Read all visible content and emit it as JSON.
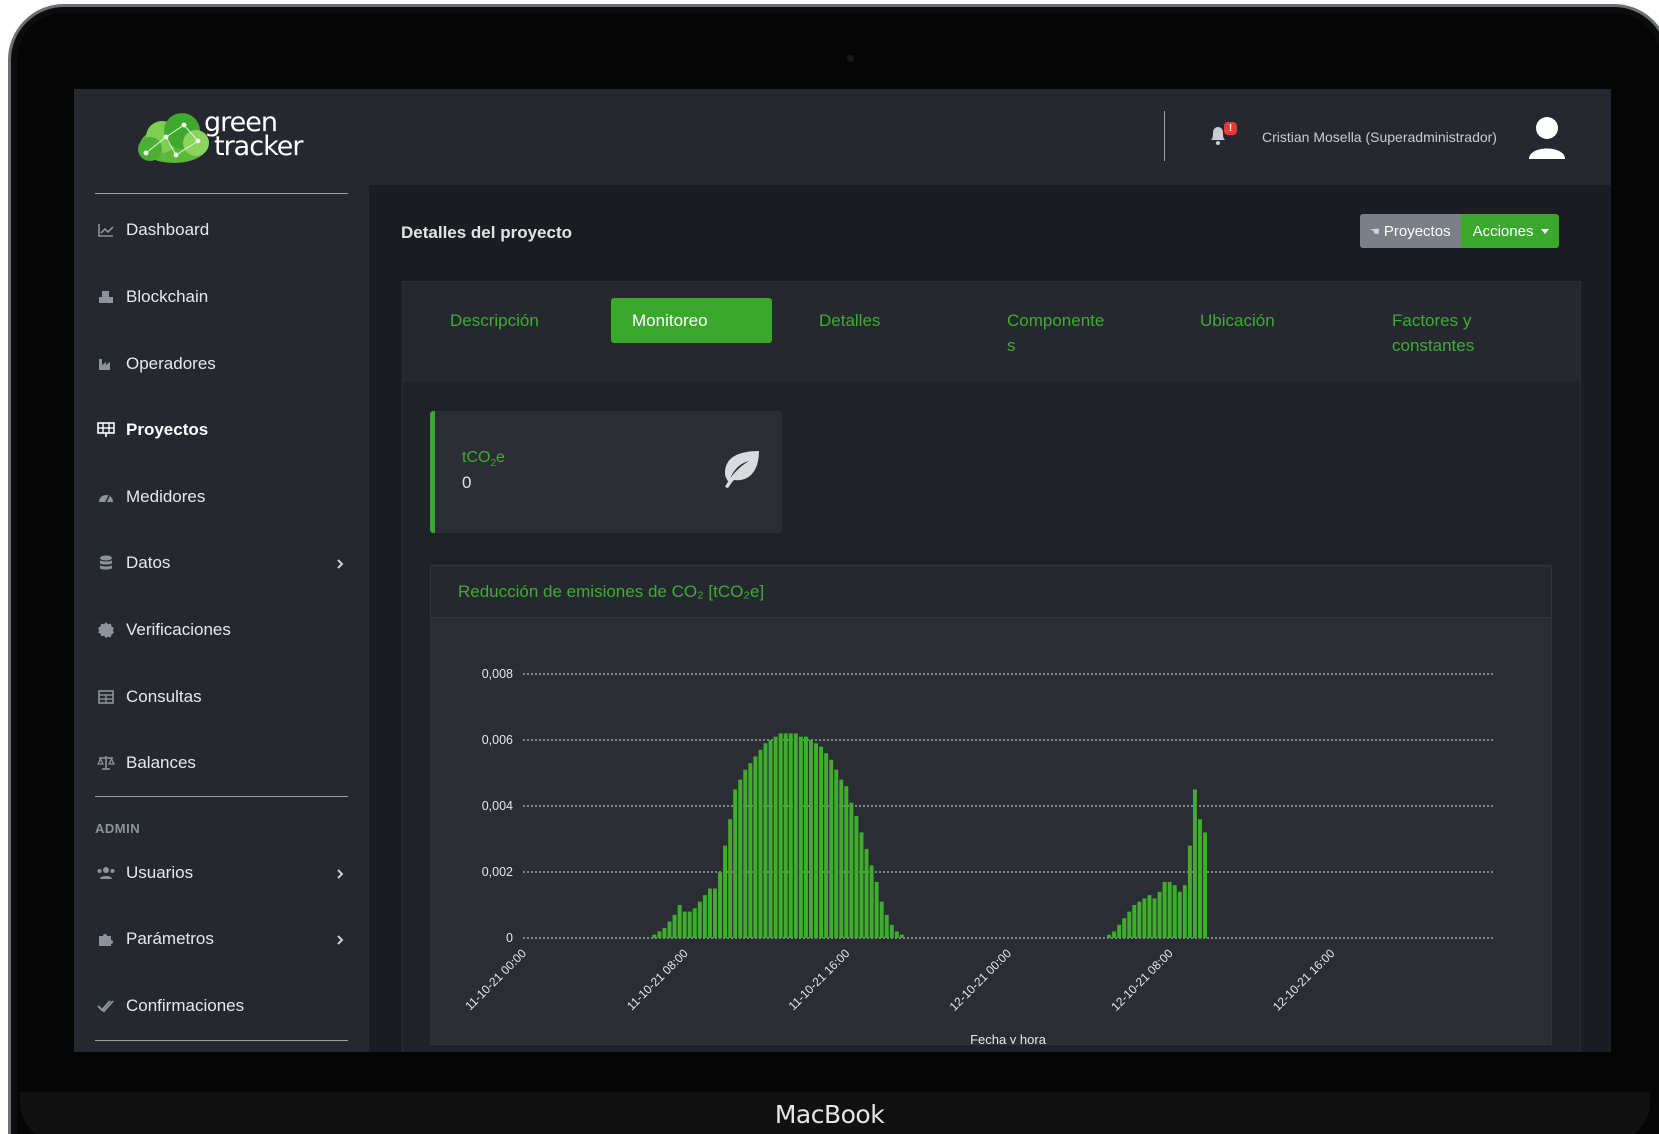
{
  "device_label": "MacBook",
  "brand": {
    "line1": "green",
    "line2": "tracker"
  },
  "sidebar": {
    "items": [
      {
        "label": "Dashboard",
        "icon": "chart-line-icon"
      },
      {
        "label": "Blockchain",
        "icon": "cubes-icon"
      },
      {
        "label": "Operadores",
        "icon": "industry-icon"
      },
      {
        "label": "Proyectos",
        "icon": "solar-panel-icon",
        "active": true
      },
      {
        "label": "Medidores",
        "icon": "gauge-icon"
      },
      {
        "label": "Datos",
        "icon": "database-icon",
        "has_submenu": true
      },
      {
        "label": "Verificaciones",
        "icon": "certificate-icon"
      },
      {
        "label": "Consultas",
        "icon": "table-icon"
      },
      {
        "label": "Balances",
        "icon": "scale-icon"
      }
    ],
    "admin_label": "ADMIN",
    "admin_items": [
      {
        "label": "Usuarios",
        "icon": "users-icon",
        "has_submenu": true
      },
      {
        "label": "Parámetros",
        "icon": "puzzle-icon",
        "has_submenu": true
      },
      {
        "label": "Confirmaciones",
        "icon": "check-double-icon"
      }
    ]
  },
  "topbar": {
    "notification_badge": "!",
    "user_name": "Cristian Mosella (Superadministrador)"
  },
  "page": {
    "title": "Detalles del proyecto",
    "buttons": {
      "projects": "Proyectos",
      "actions": "Acciones"
    }
  },
  "tabs": [
    {
      "label": "Descripción"
    },
    {
      "label": "Monitoreo",
      "active": true
    },
    {
      "label": "Detalles"
    },
    {
      "label": "Componente\ns"
    },
    {
      "label": "Ubicación"
    },
    {
      "label": "Factores y\nconstantes"
    }
  ],
  "stat": {
    "label_prefix": "tCO",
    "label_sub": "2",
    "label_suffix": "e",
    "value": "0"
  },
  "chart_title": "Reducción de emisiones de CO₂ [tCO₂e]",
  "colors": {
    "accent": "#3aa82d",
    "bar": "#3fae2c",
    "background": "#1b1d22",
    "panel": "#25282e"
  },
  "chart_data": {
    "type": "bar",
    "xlabel": "Fecha y hora",
    "ylabel": "",
    "ylim": [
      0,
      0.008
    ],
    "yticks": [
      "0",
      "0,002",
      "0,004",
      "0,006",
      "0,008"
    ],
    "xticks": [
      "11-10-21 00:00",
      "11-10-21 08:00",
      "11-10-21 16:00",
      "12-10-21 00:00",
      "12-10-21 08:00",
      "12-10-21 16:00"
    ],
    "x_start": "11-10-21 00:00",
    "x_end": "13-10-21 00:00",
    "interval_minutes": 15,
    "series": [
      {
        "segments": [
          {
            "start": "11-10-21 06:30",
            "values": [
              0.0001,
              0.0002,
              0.0003,
              0.0005,
              0.0007,
              0.001,
              0.0008,
              0.0008,
              0.0009,
              0.0011,
              0.0013,
              0.0015,
              0.0015,
              0.002,
              0.0028,
              0.0036,
              0.0045,
              0.0048,
              0.0051,
              0.0053,
              0.0055,
              0.0057,
              0.0059,
              0.006,
              0.0061,
              0.0062,
              0.0062,
              0.0062,
              0.0062,
              0.0061,
              0.0061,
              0.006,
              0.0059,
              0.0058,
              0.0056,
              0.0054,
              0.0051,
              0.0048,
              0.0046,
              0.0041,
              0.0037,
              0.0032,
              0.0027,
              0.0022,
              0.0017,
              0.0011,
              0.0007,
              0.0004,
              0.0002,
              0.0001
            ]
          },
          {
            "start": "12-10-21 05:00",
            "values": [
              0.0001,
              0.0002,
              0.0004,
              0.0006,
              0.0008,
              0.001,
              0.0011,
              0.0012,
              0.0013,
              0.0012,
              0.0014,
              0.0017,
              0.0017,
              0.0016,
              0.0014,
              0.0016,
              0.0028,
              0.0045,
              0.0036,
              0.0032
            ]
          }
        ]
      }
    ]
  }
}
